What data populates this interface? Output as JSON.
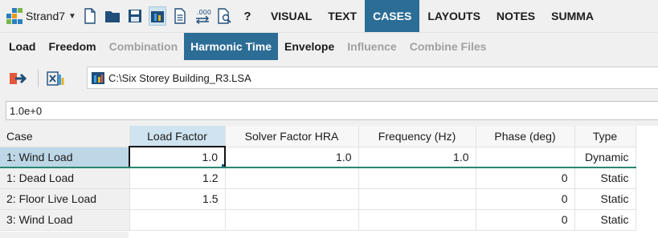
{
  "toolbar": {
    "app_label": "Strand7",
    "tabs": [
      {
        "label": "VISUAL",
        "active": false
      },
      {
        "label": "TEXT",
        "active": false
      },
      {
        "label": "CASES",
        "active": true
      },
      {
        "label": "LAYOUTS",
        "active": false
      },
      {
        "label": "NOTES",
        "active": false
      },
      {
        "label": "SUMMA",
        "active": false
      }
    ]
  },
  "subtabs": [
    {
      "label": "Load",
      "state": "normal"
    },
    {
      "label": "Freedom",
      "state": "normal"
    },
    {
      "label": "Combination",
      "state": "disabled"
    },
    {
      "label": "Harmonic Time",
      "state": "active"
    },
    {
      "label": "Envelope",
      "state": "normal"
    },
    {
      "label": "Influence",
      "state": "disabled"
    },
    {
      "label": "Combine Files",
      "state": "disabled"
    }
  ],
  "path": {
    "file_path": "C:\\Six Storey Building_R3.LSA"
  },
  "value_input": {
    "value": "1.0e+0"
  },
  "table": {
    "columns": [
      "Case",
      "Load Factor",
      "Solver Factor HRA",
      "Frequency (Hz)",
      "Phase (deg)",
      "Type"
    ],
    "rows": [
      {
        "case": "1: Wind Load",
        "load_factor": "1.0",
        "solver_factor_hra": "1.0",
        "frequency": "1.0",
        "phase": "",
        "type": "Dynamic"
      },
      {
        "case": "1: Dead Load",
        "load_factor": "1.2",
        "solver_factor_hra": "",
        "frequency": "",
        "phase": "0",
        "type": "Static"
      },
      {
        "case": "2: Floor Live Load",
        "load_factor": "1.5",
        "solver_factor_hra": "",
        "frequency": "",
        "phase": "0",
        "type": "Static"
      },
      {
        "case": "3: Wind Load",
        "load_factor": "",
        "solver_factor_hra": "",
        "frequency": "",
        "phase": "0",
        "type": "Static"
      }
    ]
  },
  "colors": {
    "accent": "#2c6d96",
    "selected_cell": "#cfe3f0",
    "row_divider": "#2b8574"
  }
}
